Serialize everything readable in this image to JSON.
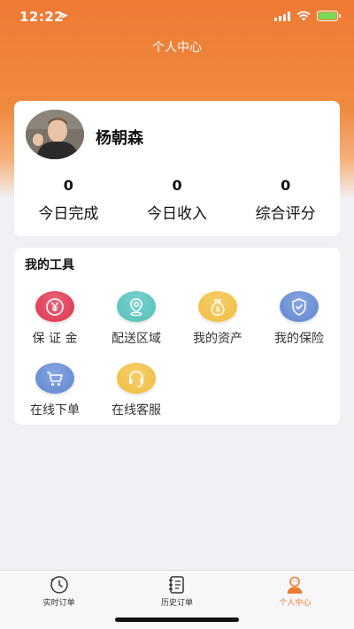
{
  "status_bar": {
    "time": "12:22",
    "location_icon": "location-arrow-icon",
    "battery_color": "#7ed957"
  },
  "header": {
    "title": "个人中心",
    "gradient_colors": [
      "#ee7a34",
      "#f5b07a"
    ]
  },
  "profile": {
    "name": "杨朝森",
    "stats": [
      {
        "value": "0",
        "label": "今日完成"
      },
      {
        "value": "0",
        "label": "今日收入"
      },
      {
        "value": "0",
        "label": "综合评分"
      }
    ]
  },
  "tools": {
    "title": "我的工具",
    "items": [
      {
        "label": "保 证 金",
        "icon": "yuan-icon",
        "color": "#e2415a"
      },
      {
        "label": "配送区域",
        "icon": "map-pin-icon",
        "color": "#5cc5c0"
      },
      {
        "label": "我的资产",
        "icon": "money-bag-icon",
        "color": "#f2c24a"
      },
      {
        "label": "我的保险",
        "icon": "shield-icon",
        "color": "#6b8fd6"
      },
      {
        "label": "在线下单",
        "icon": "cart-icon",
        "color": "#6b8fd6"
      },
      {
        "label": "在线客服",
        "icon": "headset-icon",
        "color": "#f2c24a"
      }
    ]
  },
  "tabbar": {
    "items": [
      {
        "label": "实时订单",
        "icon": "clock-icon",
        "active": false
      },
      {
        "label": "历史订单",
        "icon": "notebook-icon",
        "active": false
      },
      {
        "label": "个人中心",
        "icon": "person-icon",
        "active": true
      }
    ],
    "active_color": "#ee7a34"
  }
}
